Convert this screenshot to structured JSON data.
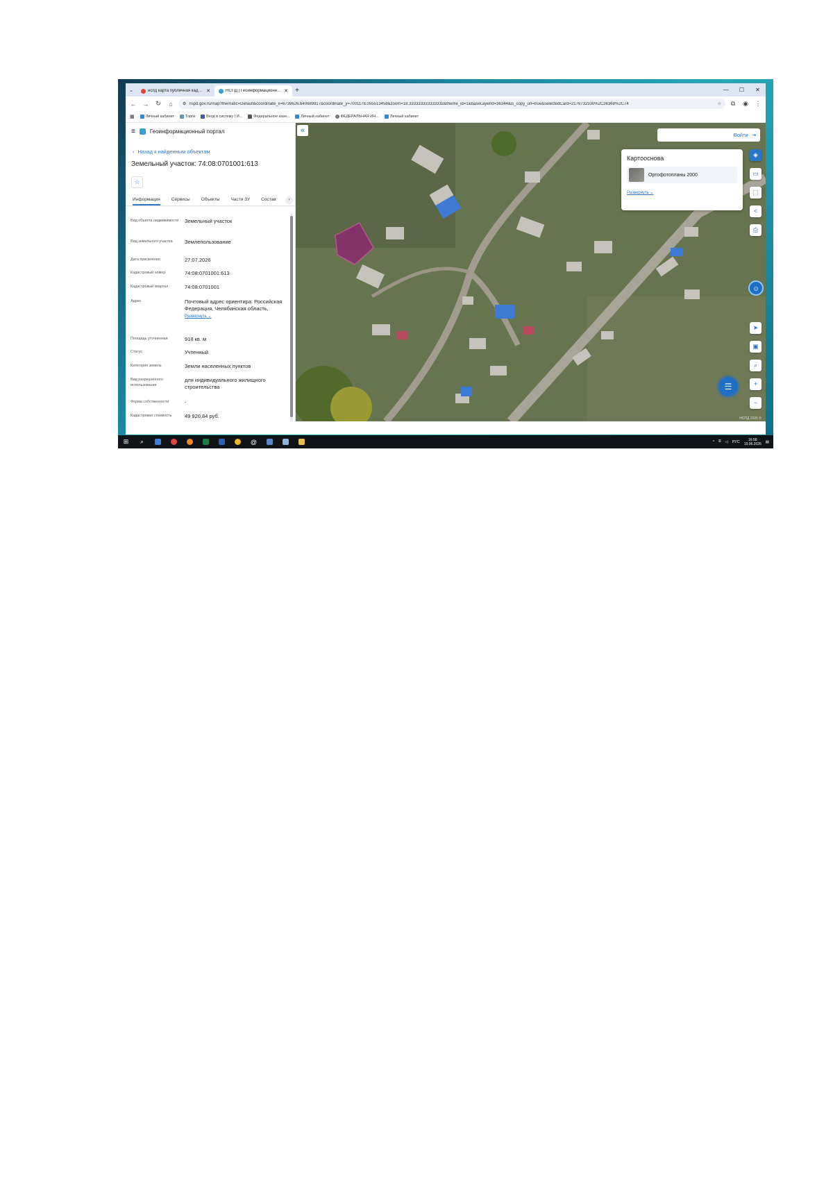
{
  "browser": {
    "tabs": [
      {
        "title": "нспд карта публичная кадастр",
        "active": false
      },
      {
        "title": "НСПД | Геоинформационный",
        "active": true
      }
    ],
    "new_tab": "+",
    "url": "nspd.gov.ru/map?thematic=Default&coordinate_x=6739626.640689917&coordinate_y=7001178.055513458&zoom=18.333333333333332&theme_id=1&baseLayerId=36344&is_copy_url=true&selectedCard=2176732330%2C36368%2C74",
    "bookmarks": [
      "Личный кабинет",
      "Торги",
      "Вход в систему | И...",
      "Федеральное казн...",
      "Личный кабинет",
      "ФЕДЕРАЛЬНАЯ ИН...",
      "Личный кабинет"
    ]
  },
  "app": {
    "title": "Геоинформационный портал",
    "back_label": "Назад к найденным объектам",
    "object_title": "Земельный участок: 74:08:0701001:613",
    "tabs": [
      "Информация",
      "Сервисы",
      "Объекты",
      "Части ЗУ",
      "Состав"
    ],
    "properties": [
      {
        "key": "Вид объекта недвижимости",
        "value": "Земельный участок"
      },
      {
        "key": "Вид земельного участка",
        "value": "Землепользование"
      },
      {
        "key": "Дата присвоения",
        "value": "27.07.2026"
      },
      {
        "key": "Кадастровый номер",
        "value": "74:08:0701001:613"
      },
      {
        "key": "Кадастровый квартал",
        "value": "74:08:0701001"
      },
      {
        "key": "Адрес",
        "value": "Почтовый адрес ориентира: Российская Федерация, Челябинская область,"
      },
      {
        "key": "Площадь уточненная",
        "value": "918 кв. м"
      },
      {
        "key": "Статус",
        "value": "Учтенный"
      },
      {
        "key": "Категория земель",
        "value": "Земли населенных пунктов"
      },
      {
        "key": "Вид разрешенного использования",
        "value": "для индивидуального жилищного строительства"
      },
      {
        "key": "Форма собственности",
        "value": "-"
      },
      {
        "key": "Кадастровая стоимость",
        "value": "49 920,84 руб."
      }
    ],
    "expand_label": "Развернуть"
  },
  "map": {
    "login_label": "Войти",
    "basemap_title": "Картооснова",
    "basemap_item": "Ортофотопланы 2000",
    "basemap_expand": "Развернуть",
    "copyright": "НСПД 2026 ©"
  },
  "taskbar": {
    "lang": "РУС",
    "time": "16:58",
    "date": "19.06.2026"
  },
  "colors": {
    "accent": "#2a74c9",
    "parcel": "#8a2a6b"
  }
}
